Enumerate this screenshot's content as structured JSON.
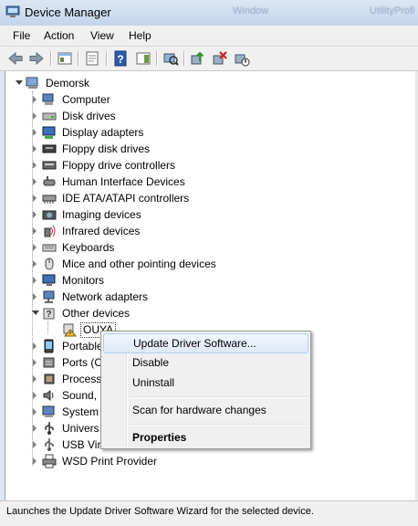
{
  "window": {
    "title": "Device Manager",
    "ghost_texts": [
      "Window",
      "Utility",
      "Profi"
    ]
  },
  "menu": {
    "file": "File",
    "action": "Action",
    "view": "View",
    "help": "Help"
  },
  "tree": {
    "root": "Demorsk",
    "items": [
      {
        "label": "Computer",
        "icon": "computer-icon"
      },
      {
        "label": "Disk drives",
        "icon": "disk-drive-icon"
      },
      {
        "label": "Display adapters",
        "icon": "display-adapter-icon"
      },
      {
        "label": "Floppy disk drives",
        "icon": "floppy-icon"
      },
      {
        "label": "Floppy drive controllers",
        "icon": "floppy-controller-icon"
      },
      {
        "label": "Human Interface Devices",
        "icon": "hid-icon"
      },
      {
        "label": "IDE ATA/ATAPI controllers",
        "icon": "ide-icon"
      },
      {
        "label": "Imaging devices",
        "icon": "camera-icon"
      },
      {
        "label": "Infrared devices",
        "icon": "infrared-icon"
      },
      {
        "label": "Keyboards",
        "icon": "keyboard-icon"
      },
      {
        "label": "Mice and other pointing devices",
        "icon": "mouse-icon"
      },
      {
        "label": "Monitors",
        "icon": "monitor-icon"
      },
      {
        "label": "Network adapters",
        "icon": "network-icon"
      },
      {
        "label": "Other devices",
        "icon": "unknown-device-icon"
      },
      {
        "label": "OUYA",
        "icon": "warning-device-icon"
      },
      {
        "label": "Portable",
        "icon": "portable-device-icon"
      },
      {
        "label": "Ports (C",
        "icon": "ports-icon"
      },
      {
        "label": "Process",
        "icon": "processor-icon"
      },
      {
        "label": "Sound, ",
        "icon": "sound-icon"
      },
      {
        "label": "System ",
        "icon": "system-icon"
      },
      {
        "label": "Univers",
        "icon": "usb-icon"
      },
      {
        "label": "USB Virt",
        "icon": "usb-virtual-icon"
      },
      {
        "label": "WSD Print Provider",
        "icon": "printer-icon"
      }
    ]
  },
  "context_menu": {
    "update": "Update Driver Software...",
    "disable": "Disable",
    "uninstall": "Uninstall",
    "scan": "Scan for hardware changes",
    "properties": "Properties"
  },
  "status": "Launches the Update Driver Software Wizard for the selected device.",
  "colors": {
    "selection_border": "#aecff7",
    "title_bg": "#c3d5ea",
    "warning": "#f2c744"
  }
}
